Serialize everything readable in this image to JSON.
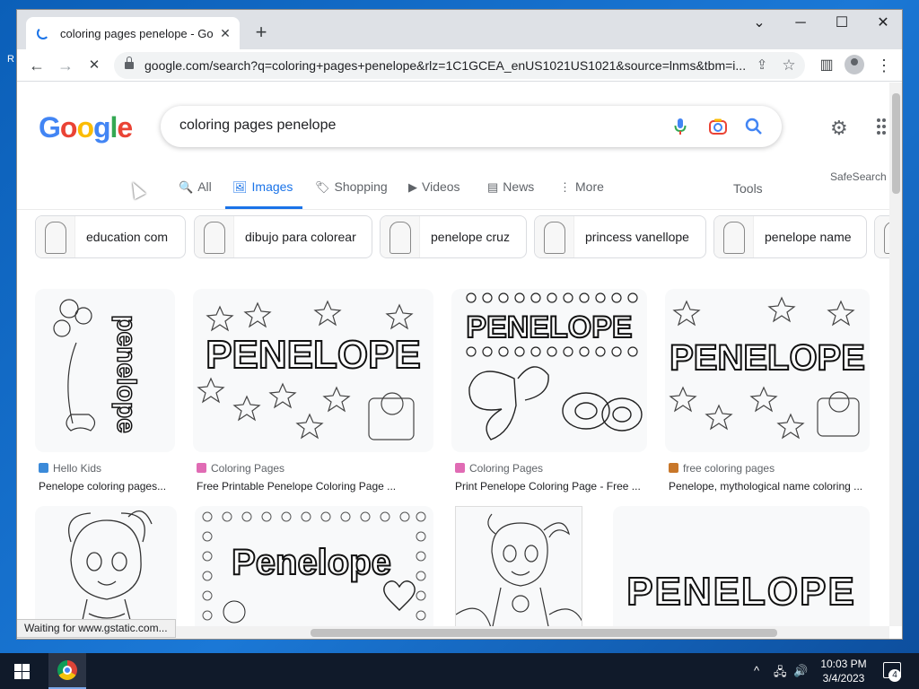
{
  "desktop": {
    "char": "R"
  },
  "tab": {
    "title": "coloring pages penelope - Google Search",
    "close": "✕"
  },
  "newtab": "+",
  "window_controls": {
    "dropdown": "⌄",
    "minimize": "─",
    "maximize": "☐",
    "close": "✕"
  },
  "toolbar": {
    "back": "←",
    "forward": "→",
    "reload": "✕",
    "url": "google.com/search?q=coloring+pages+penelope&rlz=1C1GCEA_enUS1021US1021&source=lnms&tbm=i...",
    "share": "⇪",
    "bookmark": "☆",
    "sidepanel": "▥",
    "menu": "⋮"
  },
  "search": {
    "logo": [
      "G",
      "o",
      "o",
      "g",
      "l",
      "e"
    ],
    "query": "coloring pages penelope",
    "mic": "🎙",
    "lens": "◉",
    "search": "🔍"
  },
  "settings": "⚙",
  "nav": {
    "tabs": [
      {
        "icon": "🔍",
        "label": "All"
      },
      {
        "icon": "🖼",
        "label": "Images"
      },
      {
        "icon": "🏷",
        "label": "Shopping"
      },
      {
        "icon": "▶",
        "label": "Videos"
      },
      {
        "icon": "▤",
        "label": "News"
      },
      {
        "icon": "⋮",
        "label": "More"
      }
    ],
    "tools": "Tools",
    "safesearch": "SafeSearch"
  },
  "chips": [
    "education com",
    "dibujo para colorear",
    "penelope cruz",
    "princess vanellope",
    "penelope name"
  ],
  "results": [
    {
      "source": "Hello Kids",
      "caption": "Penelope coloring pages...",
      "image_text": "penelope"
    },
    {
      "source": "Coloring Pages",
      "caption": "Free Printable Penelope Coloring Page ...",
      "image_text": "PENELOPE"
    },
    {
      "source": "Coloring Pages",
      "caption": "Print Penelope Coloring Page - Free ...",
      "image_text": "PENELOPE"
    },
    {
      "source": "free coloring pages",
      "caption": "Penelope, mythological name coloring ...",
      "image_text": "PENELOPE"
    },
    {
      "source": "",
      "caption": "",
      "image_text": ""
    },
    {
      "source": "",
      "caption": "",
      "image_text": "Penelope"
    },
    {
      "source": "",
      "caption": "",
      "image_text": ""
    },
    {
      "source": "",
      "caption": "",
      "image_text": "PENELOPE"
    }
  ],
  "status": "Waiting for www.gstatic.com...",
  "taskbar": {
    "time": "10:03 PM",
    "date": "3/4/2023",
    "tray_up": "^",
    "network": "🖧",
    "volume": "🔊",
    "notifications": "4"
  },
  "colors": {
    "accent": "#1a73e8",
    "desktop": "#1f6fc1",
    "taskbar": "#101a2a"
  }
}
